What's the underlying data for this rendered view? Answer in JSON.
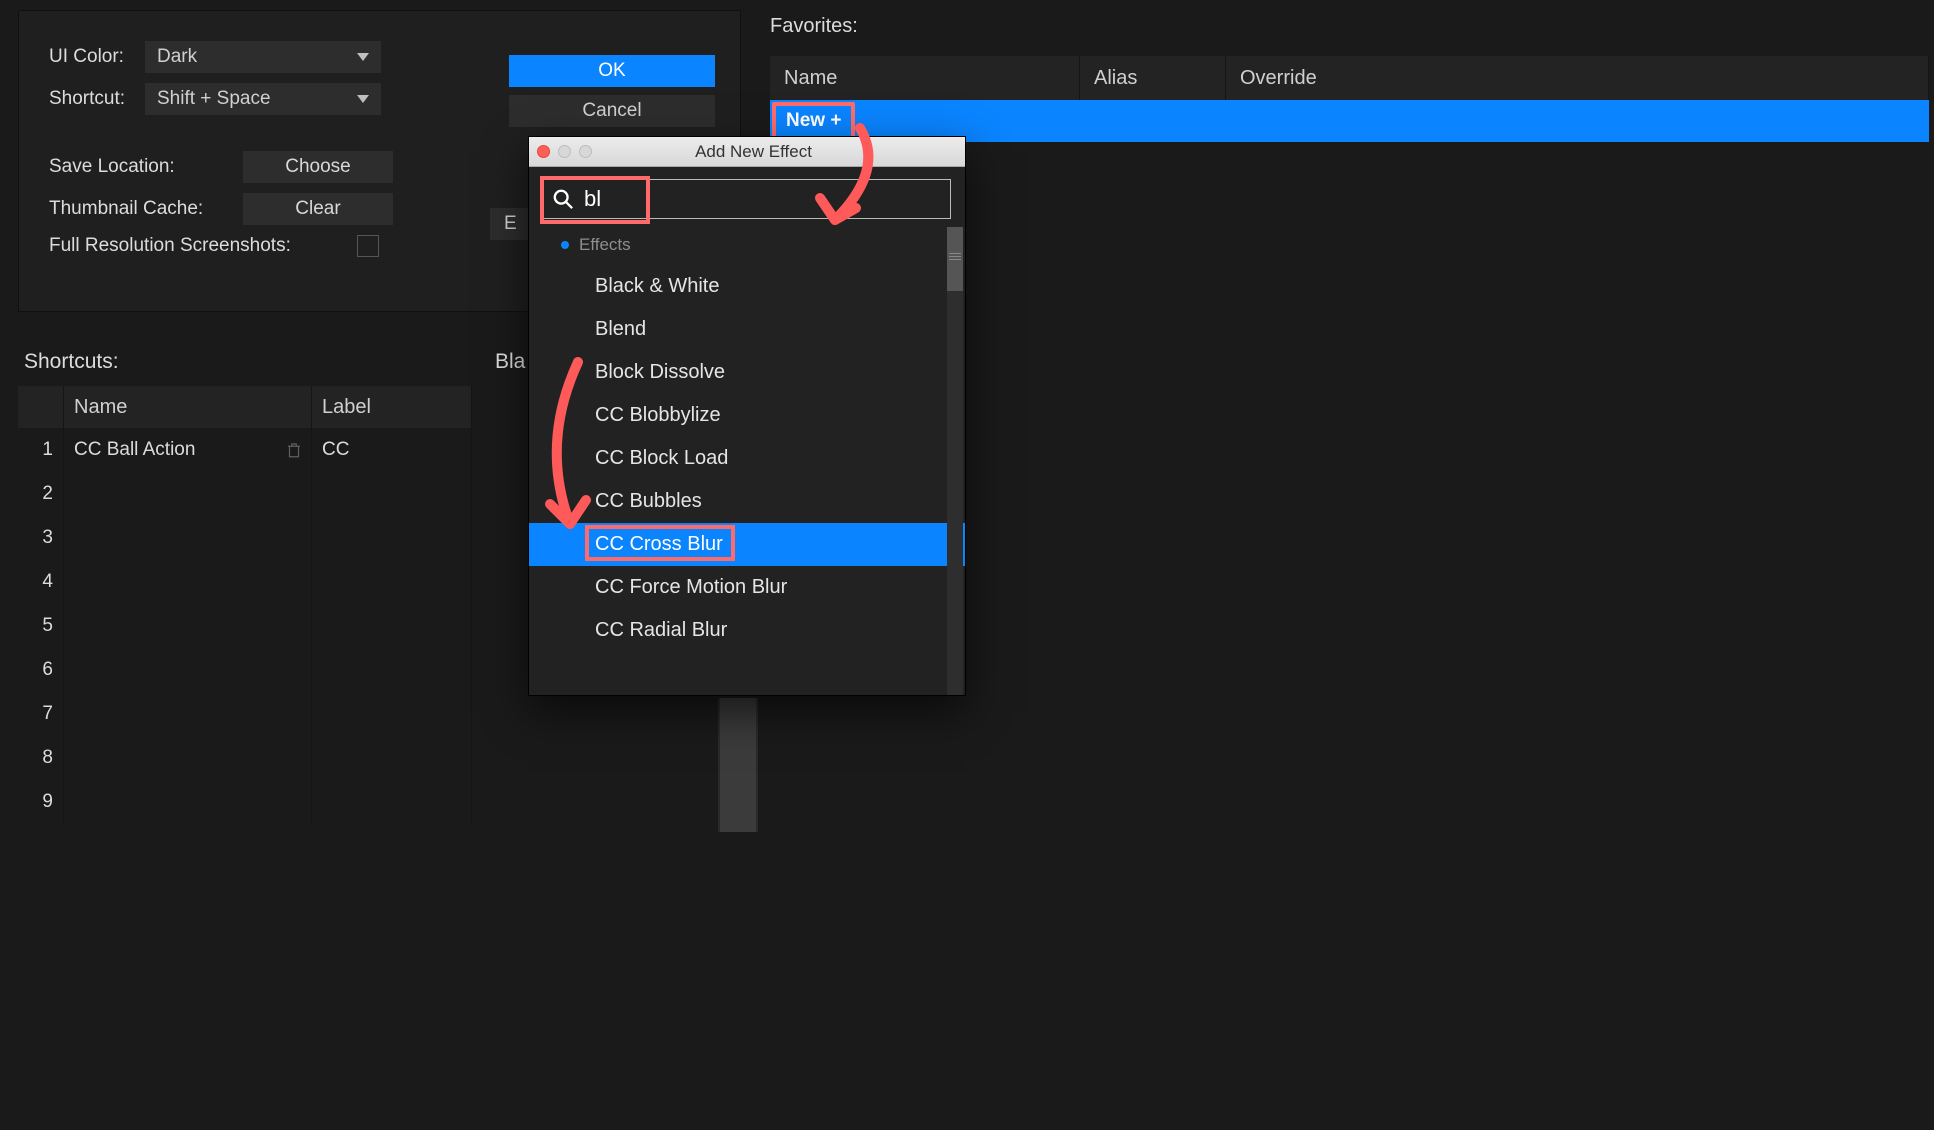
{
  "settings": {
    "ui_color_label": "UI Color:",
    "ui_color_value": "Dark",
    "shortcut_label": "Shortcut:",
    "shortcut_value": "Shift + Space",
    "save_location_label": "Save Location:",
    "choose_label": "Choose",
    "thumb_cache_label": "Thumbnail Cache:",
    "clear_label": "Clear",
    "full_res_label": "Full Resolution Screenshots:",
    "ok_label": "OK",
    "cancel_label": "Cancel",
    "hidden_e_prefix": "E"
  },
  "favorites": {
    "title": "Favorites:",
    "columns": {
      "name": "Name",
      "alias": "Alias",
      "override": "Override"
    },
    "new_button": "New +"
  },
  "shortcuts": {
    "title": "Shortcuts:",
    "mid_partial": "Bla",
    "columns": {
      "name": "Name",
      "label": "Label"
    },
    "rows": [
      {
        "idx": "1",
        "name": "CC Ball Action",
        "label": "CC"
      },
      {
        "idx": "2",
        "name": "",
        "label": ""
      },
      {
        "idx": "3",
        "name": "",
        "label": ""
      },
      {
        "idx": "4",
        "name": "",
        "label": ""
      },
      {
        "idx": "5",
        "name": "",
        "label": ""
      },
      {
        "idx": "6",
        "name": "",
        "label": ""
      },
      {
        "idx": "7",
        "name": "",
        "label": ""
      },
      {
        "idx": "8",
        "name": "",
        "label": ""
      },
      {
        "idx": "9",
        "name": "",
        "label": ""
      }
    ]
  },
  "modal": {
    "title": "Add New Effect",
    "search_value": "bl",
    "category": "Effects",
    "effects": [
      "Black & White",
      "Blend",
      "Block Dissolve",
      "CC Blobbylize",
      "CC Block Load",
      "CC Bubbles",
      "CC Cross Blur",
      "CC Force Motion Blur",
      "CC Radial Blur"
    ],
    "selected_index": 6
  },
  "annotation_color": "#ff6b6b"
}
